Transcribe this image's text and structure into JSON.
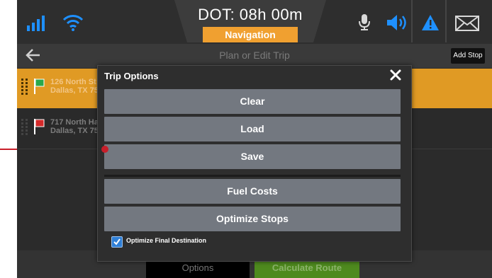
{
  "status": {
    "dot_title": "DOT: 08h 00m",
    "nav_tab": "Navigation",
    "icons": [
      "signal-icon",
      "wifi-icon",
      "microphone-icon",
      "speaker-icon",
      "warning-icon",
      "mail-icon"
    ],
    "accent": "#f0a030",
    "icon_blue": "#1e90ff"
  },
  "titlebar": {
    "title": "Plan or Edit Trip",
    "add_stop": "Add Stop"
  },
  "stops": [
    {
      "line1": "126 North St",
      "line2": "Dallas, TX 75",
      "flag_color": "#2aa84a"
    },
    {
      "line1": "717 North Ha",
      "line2": "Dallas, TX 75",
      "flag_color": "#d42a2a"
    }
  ],
  "modal": {
    "title": "Trip Options",
    "buttons": [
      "Clear",
      "Load",
      "Save",
      "Fuel Costs",
      "Optimize Stops"
    ],
    "checkbox_label": "Optimize Final Destination",
    "checkbox_checked": true
  },
  "bottom": {
    "options": "Options",
    "calculate": "Calculate Route"
  },
  "colors": {
    "selected_stop": "#e09a24",
    "modal_button": "#737880",
    "calculate": "#4e8a1e",
    "pointer": "#c81e2a"
  }
}
